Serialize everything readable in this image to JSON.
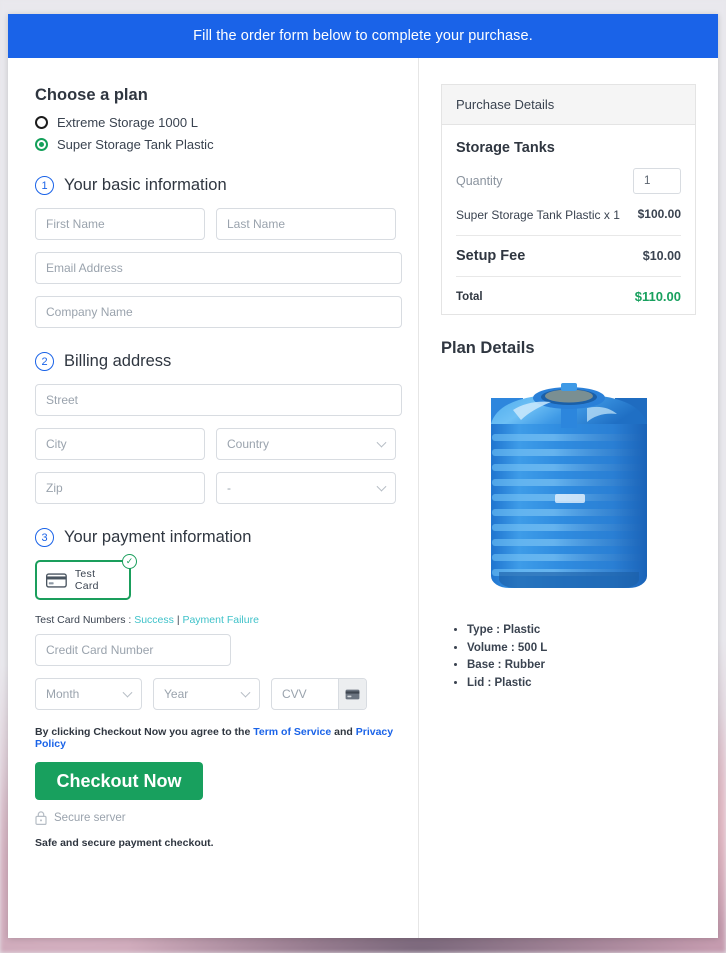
{
  "banner": {
    "text": "Fill the order form below to complete your purchase."
  },
  "plans": {
    "heading": "Choose a plan",
    "options": [
      {
        "label": "Extreme Storage 1000 L",
        "selected": false
      },
      {
        "label": "Super Storage Tank Plastic",
        "selected": true
      }
    ]
  },
  "step1": {
    "number": "1",
    "title": "Your basic information",
    "first_name_placeholder": "First Name",
    "last_name_placeholder": "Last Name",
    "email_placeholder": "Email Address",
    "company_placeholder": "Company Name"
  },
  "step2": {
    "number": "2",
    "title": "Billing address",
    "street_placeholder": "Street",
    "city_placeholder": "City",
    "country_placeholder": "Country",
    "zip_placeholder": "Zip",
    "state_placeholder": "-"
  },
  "step3": {
    "number": "3",
    "title": "Your payment information",
    "card_tile_label": "Test  Card",
    "test_numbers_label": "Test Card Numbers :",
    "success_link": "Success",
    "separator": "|",
    "failure_link": "Payment Failure",
    "card_number_placeholder": "Credit Card Number",
    "month_placeholder": "Month",
    "year_placeholder": "Year",
    "cvv_placeholder": "CVV"
  },
  "footer": {
    "terms_prefix": "By clicking Checkout Now you agree to the ",
    "terms_link": "Term of Service",
    "terms_mid": " and ",
    "privacy_link": "Privacy Policy",
    "checkout_label": "Checkout Now",
    "secure_server": "Secure server",
    "safe_note": "Safe and secure payment checkout."
  },
  "purchase": {
    "header": "Purchase Details",
    "product_title": "Storage Tanks",
    "quantity_label": "Quantity",
    "quantity_value": "1",
    "line_item_name": "Super Storage Tank Plastic x 1",
    "line_item_amount": "$100.00",
    "setup_fee_label": "Setup Fee",
    "setup_fee_amount": "$10.00",
    "total_label": "Total",
    "total_amount": "$110.00",
    "total_color": "#18a05e"
  },
  "plan_details": {
    "heading": "Plan Details",
    "image_name": "blue-plastic-water-storage-tank",
    "specs": [
      "Type : Plastic",
      "Volume : 500 L",
      "Base : Rubber",
      "Lid : Plastic"
    ]
  },
  "theme": {
    "banner_blue": "#1a63e8",
    "green": "#18a05e",
    "link_teal": "#3fc2c9"
  }
}
